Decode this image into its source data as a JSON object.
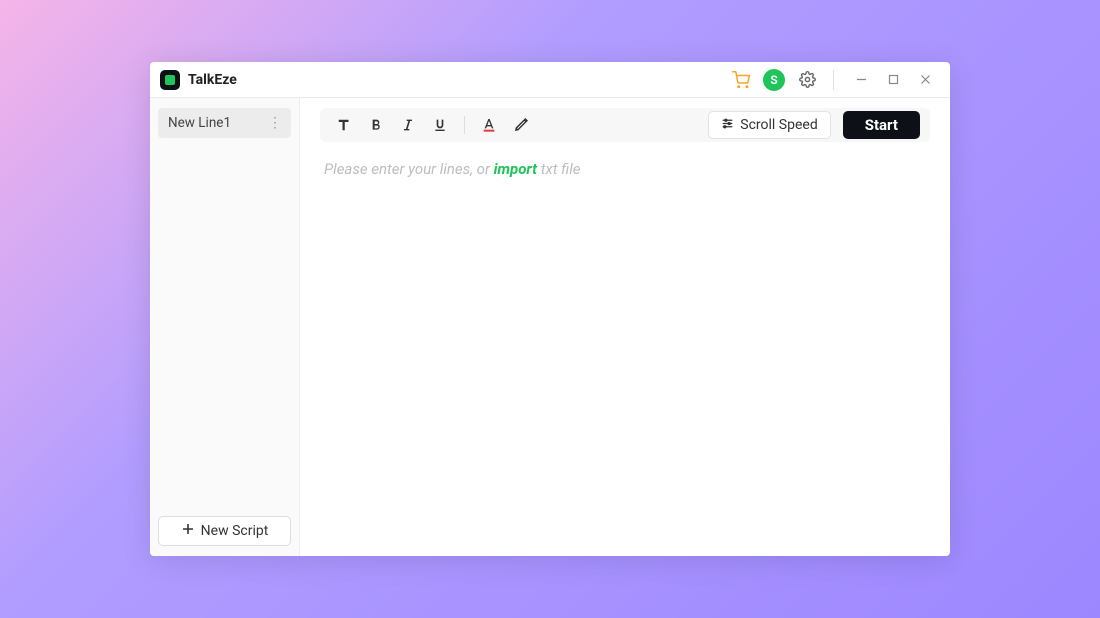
{
  "app": {
    "title": "TalkEze",
    "avatar_letter": "S"
  },
  "sidebar": {
    "items": [
      {
        "label": "New Line1"
      }
    ],
    "new_script_label": "New Script"
  },
  "toolbar": {
    "scroll_speed_label": "Scroll Speed",
    "start_label": "Start"
  },
  "editor": {
    "placeholder_prefix": "Please enter your lines, or ",
    "import_label": "import",
    "placeholder_suffix": " txt file"
  }
}
